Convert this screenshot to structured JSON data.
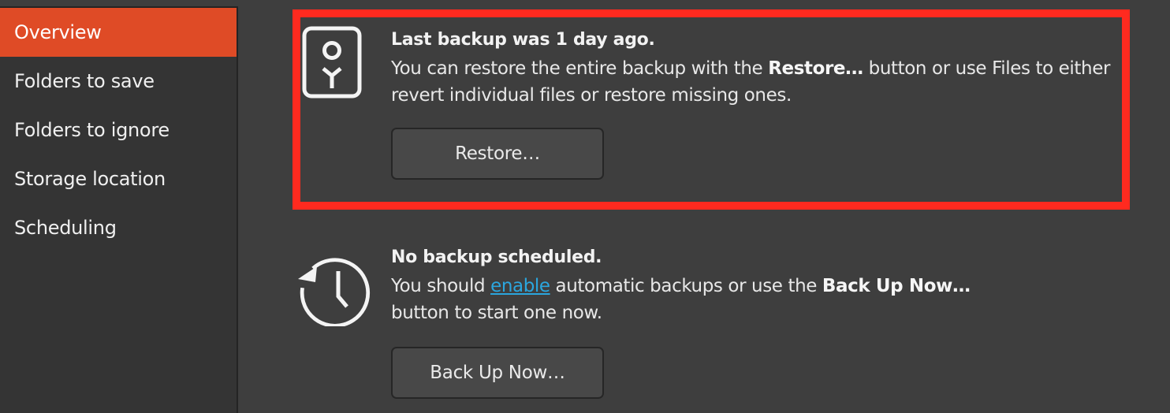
{
  "sidebar": {
    "items": [
      {
        "label": "Overview",
        "selected": true
      },
      {
        "label": "Folders to save",
        "selected": false
      },
      {
        "label": "Folders to ignore",
        "selected": false
      },
      {
        "label": "Storage location",
        "selected": false
      },
      {
        "label": "Scheduling",
        "selected": false
      }
    ]
  },
  "restore_section": {
    "icon": "safe-restore-icon",
    "heading": "Last backup was 1 day ago.",
    "body_part1": "You can restore the entire backup with the ",
    "body_bold": "Restore…",
    "body_part2": " button or use Files to either revert individual files or restore missing ones.",
    "button_label": "Restore…",
    "highlighted": true,
    "highlight_color": "#ff2a1f"
  },
  "schedule_section": {
    "icon": "history-clock-icon",
    "heading": "No backup scheduled.",
    "body_part1": "You should ",
    "link_text": "enable",
    "body_part2": " automatic backups or use the ",
    "body_bold": "Back Up Now…",
    "body_part3": " button to start one now.",
    "button_label": "Back Up Now…"
  },
  "colors": {
    "accent": "#df4b26",
    "link": "#2ba6de",
    "background": "#3e3e3e",
    "sidebar_background": "#343434"
  }
}
